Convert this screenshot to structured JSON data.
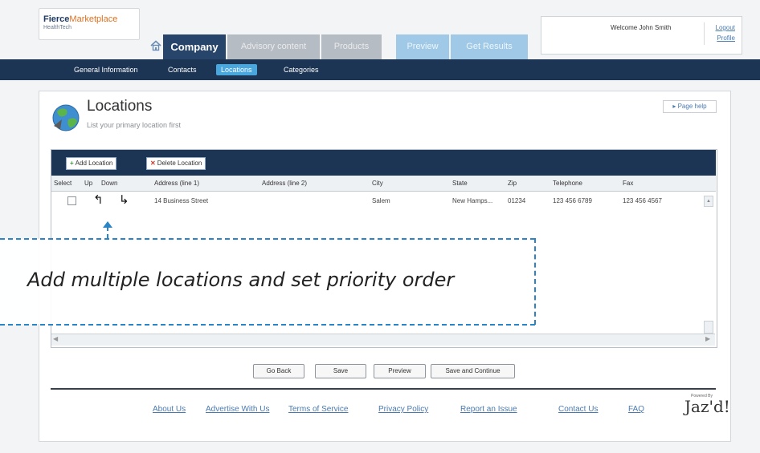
{
  "header": {
    "logo_main": "Fierce",
    "logo_accent": "Marketplace",
    "logo_sub": "HealthTech",
    "tabs": [
      "Company",
      "Advisory content",
      "Products",
      "Preview",
      "Get Results"
    ],
    "welcome": "Welcome John Smith",
    "logout": "Logout",
    "profile": "Profile"
  },
  "subnav": {
    "items": [
      "General Information",
      "Contacts",
      "Locations",
      "Categories"
    ]
  },
  "page": {
    "title": "Locations",
    "subtitle": "List your primary location first",
    "help": "▸ Page help"
  },
  "grid": {
    "add_label": "Add Location",
    "delete_label": "Delete Location",
    "columns": [
      "Select",
      "Up",
      "Down",
      "Address (line 1)",
      "Address (line 2)",
      "City",
      "State",
      "Zip",
      "Telephone",
      "Fax"
    ],
    "rows": [
      {
        "address1": "14 Business Street",
        "address2": "",
        "city": "Salem",
        "state": "New Hamps...",
        "zip": "01234",
        "telephone": "123 456 6789",
        "fax": "123 456 4567"
      }
    ]
  },
  "actions": {
    "go_back": "Go Back",
    "save": "Save",
    "preview": "Preview",
    "save_continue": "Save and Continue"
  },
  "footer": {
    "links": [
      "About Us",
      "Advertise With Us",
      "Terms of Service",
      "Privacy Policy",
      "Report an Issue",
      "Contact Us",
      "FAQ"
    ],
    "powered": "Powered By",
    "brand": "Jaz'd!"
  },
  "annotation": {
    "text": "Add multiple locations and set priority order"
  },
  "colors": {
    "nav_dark": "#1d3554",
    "tab_active": "#27456b",
    "accent_blue": "#49a7de",
    "callout_blue": "#2a84c6"
  }
}
